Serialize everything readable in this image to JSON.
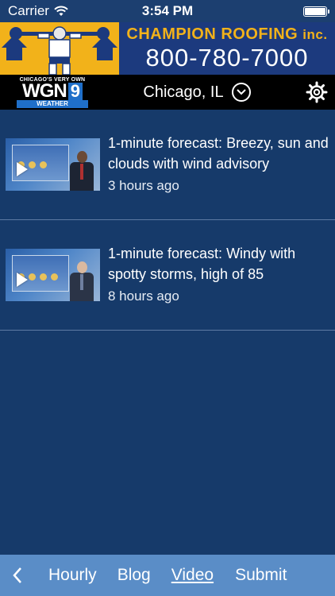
{
  "status_bar": {
    "carrier": "Carrier",
    "time": "3:54 PM"
  },
  "ad": {
    "company": "CHAMPION ROOFING",
    "company_suffix": "inc.",
    "phone": "800-780-7000",
    "colors": {
      "yellow": "#f2b21a",
      "blue": "#1c3a7e"
    }
  },
  "header": {
    "logo": {
      "top": "CHICAGO'S VERY OWN",
      "wgn": "WGN",
      "nine": "9",
      "bottom": "WEATHER"
    },
    "location": "Chicago, IL"
  },
  "videos": [
    {
      "title": "1-minute forecast: Breezy, sun and clouds with wind advisory",
      "age": "3 hours ago"
    },
    {
      "title": "1-minute forecast: Windy with spotty storms, high of 85",
      "age": "8 hours ago"
    }
  ],
  "nav": {
    "items": [
      "Hourly",
      "Blog",
      "Video",
      "Submit"
    ],
    "active": "Video"
  },
  "colors": {
    "background": "#163a6a",
    "header": "#000000",
    "nav": "#5a8dc7"
  }
}
